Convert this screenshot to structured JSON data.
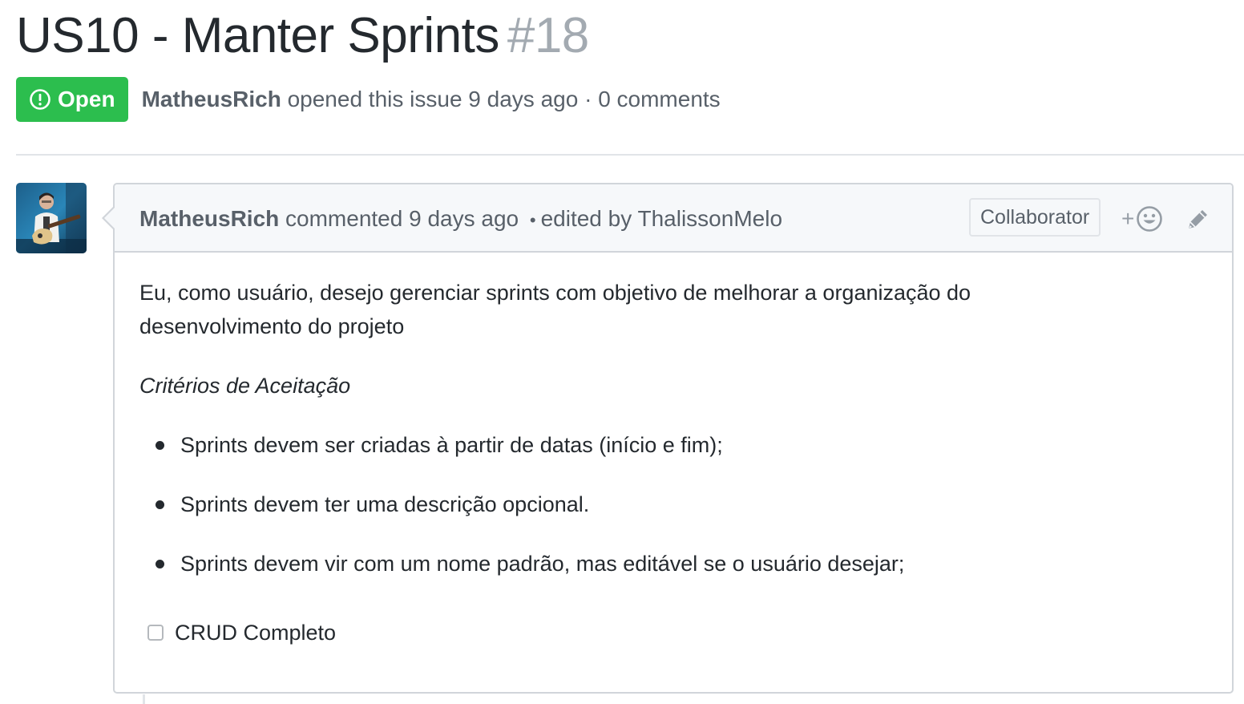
{
  "issue": {
    "title": "US10 - Manter Sprints",
    "number": "#18",
    "state": "Open",
    "author": "MatheusRich",
    "opened_text": "opened this issue 9 days ago",
    "separator": "·",
    "comments_count": "0 comments"
  },
  "comment": {
    "author": "MatheusRich",
    "action_text": "commented 9 days ago",
    "bullet": "•",
    "edited_text": "edited by ThalissonMelo",
    "role_label": "Collaborator",
    "reaction_plus": "+",
    "icons": {
      "reaction": "smiley-icon",
      "edit": "pencil-icon",
      "state": "issue-opened-icon"
    },
    "body": {
      "paragraph": "Eu, como usuário, desejo gerenciar sprints com objetivo de melhorar a organização do desenvolvimento do projeto",
      "criteria_heading": "Critérios de Aceitação",
      "criteria": [
        "Sprints devem ser criadas à partir de datas (início e fim);",
        "Sprints devem ter uma descrição opcional.",
        "Sprints devem vir com um nome padrão, mas editável se o usuário desejar;"
      ],
      "task": {
        "label": "CRUD Completo",
        "checked": false
      }
    }
  },
  "colors": {
    "open_badge": "#2cbe4e",
    "muted_text": "#586069",
    "issue_number": "#a3aab1",
    "border": "#d1d5da",
    "header_bg": "#f6f8fa"
  }
}
